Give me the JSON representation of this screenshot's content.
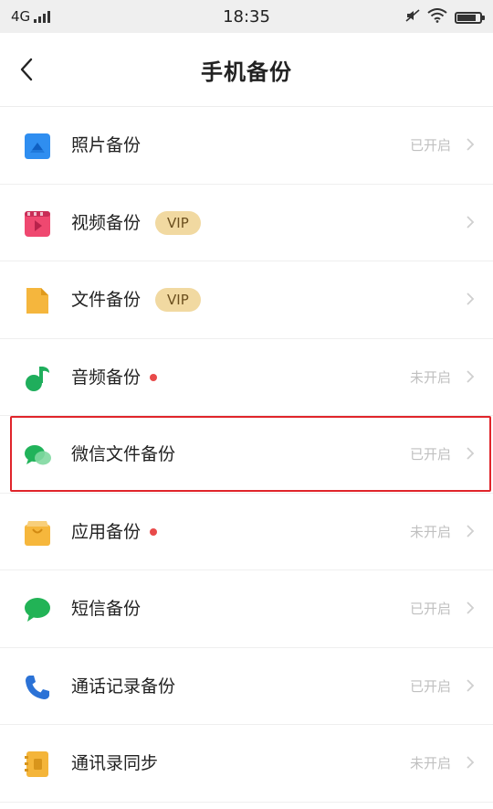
{
  "status_bar": {
    "network": "4G",
    "time": "18:35",
    "battery_level": 0.85
  },
  "header": {
    "title": "手机备份",
    "back_icon": "back-arrow-icon"
  },
  "items": [
    {
      "label": "照片备份",
      "status": "已开启",
      "icon": "photo-icon",
      "icon_color": "#2f8ef0",
      "badge": ""
    },
    {
      "label": "视频备份",
      "status": "",
      "icon": "video-icon",
      "icon_color": "#ef4870",
      "badge": "VIP"
    },
    {
      "label": "文件备份",
      "status": "",
      "icon": "file-icon",
      "icon_color": "#f5b63d",
      "badge": "VIP"
    },
    {
      "label": "音频备份",
      "status": "未开启",
      "icon": "music-icon",
      "icon_color": "#1fae5c",
      "badge": ""
    },
    {
      "label": "微信文件备份",
      "status": "已开启",
      "icon": "wechat-icon",
      "icon_color": "#21b35a",
      "badge": ""
    },
    {
      "label": "应用备份",
      "status": "未开启",
      "icon": "app-icon",
      "icon_color": "#f6b73c",
      "badge": ""
    },
    {
      "label": "短信备份",
      "status": "已开启",
      "icon": "sms-icon",
      "icon_color": "#22b356",
      "badge": ""
    },
    {
      "label": "通话记录备份",
      "status": "已开启",
      "icon": "phone-icon",
      "icon_color": "#2b72d6",
      "badge": ""
    },
    {
      "label": "通讯录同步",
      "status": "未开启",
      "icon": "contacts-icon",
      "icon_color": "#f4b53a",
      "badge": ""
    }
  ],
  "colors": {
    "highlight": "#e0252b",
    "dot": "#e84a4a",
    "vip_badge_bg": "#f1d9a1",
    "status_text": "#c0c0c0"
  }
}
